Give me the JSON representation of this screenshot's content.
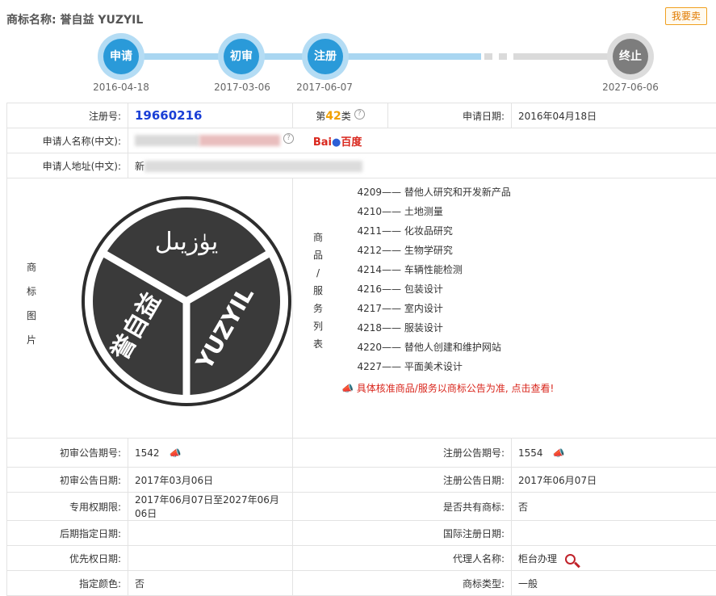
{
  "header": {
    "title_label": "商标名称:",
    "title_value": "誉自益 YUZYIL",
    "buy_button": "我要卖"
  },
  "timeline": {
    "steps": [
      {
        "label": "申请",
        "date": "2016-04-18"
      },
      {
        "label": "初审",
        "date": "2017-03-06"
      },
      {
        "label": "注册",
        "date": "2017-06-07"
      },
      {
        "label": "终止",
        "date": "2027-06-06"
      }
    ]
  },
  "info": {
    "reg_no_label": "注册号:",
    "reg_no": "19660216",
    "class_prefix": "第",
    "class_num": "42",
    "class_suffix": "类",
    "apply_date_label": "申请日期:",
    "apply_date": "2016年04月18日",
    "applicant_label": "申请人名称(中文):",
    "baidu_text": "Bai",
    "baidu_cn": "百度",
    "address_label": "申请人地址(中文):",
    "address_prefix": "新",
    "image_label_chars": [
      "商",
      "标",
      "图",
      "片"
    ],
    "goods_label_chars": [
      "商",
      "品",
      "/",
      "服",
      "务",
      "列",
      "表"
    ],
    "services": [
      {
        "code": "4209",
        "name": "替他人研究和开发新产品"
      },
      {
        "code": "4210",
        "name": "土地测量"
      },
      {
        "code": "4211",
        "name": "化妆品研究"
      },
      {
        "code": "4212",
        "name": "生物学研究"
      },
      {
        "code": "4214",
        "name": "车辆性能检测"
      },
      {
        "code": "4216",
        "name": "包装设计"
      },
      {
        "code": "4217",
        "name": "室内设计"
      },
      {
        "code": "4218",
        "name": "服装设计"
      },
      {
        "code": "4220",
        "name": "替他人创建和维护网站"
      },
      {
        "code": "4227",
        "name": "平面美术设计"
      }
    ],
    "service_note": "具体核准商品/服务以商标公告为准, 点击查看!",
    "prelim_no_label": "初审公告期号:",
    "prelim_no": "1542",
    "reg_pub_no_label": "注册公告期号:",
    "reg_pub_no": "1554",
    "prelim_date_label": "初审公告日期:",
    "prelim_date": "2017年03月06日",
    "reg_pub_date_label": "注册公告日期:",
    "reg_pub_date": "2017年06月07日",
    "exclusive_label": "专用权期限:",
    "exclusive_value": "2017年06月07日至2027年06月06日",
    "shared_label": "是否共有商标:",
    "shared_value": "否",
    "later_label": "后期指定日期:",
    "intl_label": "国际注册日期:",
    "priority_label": "优先权日期:",
    "agent_label": "代理人名称:",
    "agent_value": "柜台办理",
    "cut_label": "指定颜色:",
    "cut_value": "否",
    "type_label": "商标类型:",
    "type_value": "一般"
  },
  "logo": {
    "text_top": "يۈزيىل",
    "text_left": "誉自益",
    "text_right": "YUZYIL"
  },
  "colors": {
    "accent_blue": "#2a9ad9",
    "grey": "#7d7d7d",
    "orange": "#f0a000",
    "red": "#d9261c"
  }
}
